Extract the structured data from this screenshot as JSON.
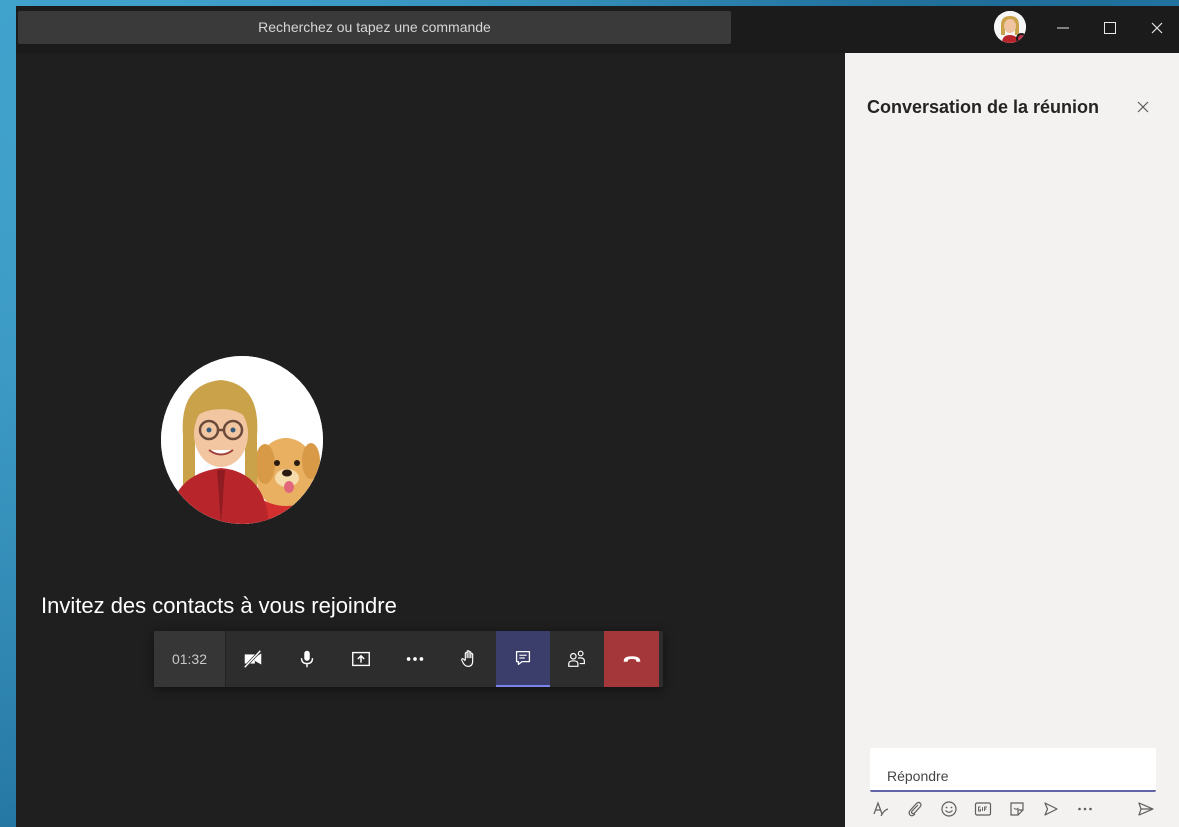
{
  "titlebar": {
    "search_placeholder": "Recherchez ou tapez une commande",
    "window_controls": [
      "minimize-icon",
      "maximize-icon",
      "close-icon"
    ]
  },
  "stage": {
    "invite_text": "Invitez des contacts à vous rejoindre"
  },
  "call_bar": {
    "timer": "01:32",
    "buttons": [
      "camera-off-icon",
      "microphone-icon",
      "share-screen-icon",
      "more-icon",
      "raise-hand-icon",
      "chat-icon",
      "participants-icon",
      "hang-up-icon"
    ],
    "active": "chat-icon",
    "hangup_color": "#a4373a"
  },
  "chat_panel": {
    "title": "Conversation de la réunion",
    "reply_placeholder": "Répondre",
    "tools": [
      "format-icon",
      "attach-icon",
      "emoji-icon",
      "gif-icon",
      "sticker-icon",
      "meet-now-icon",
      "more-options-icon",
      "send-icon"
    ]
  },
  "colors": {
    "accent": "#6264a7",
    "stage_bg": "#1f1f1f",
    "panel_bg": "#f3f2f1"
  }
}
